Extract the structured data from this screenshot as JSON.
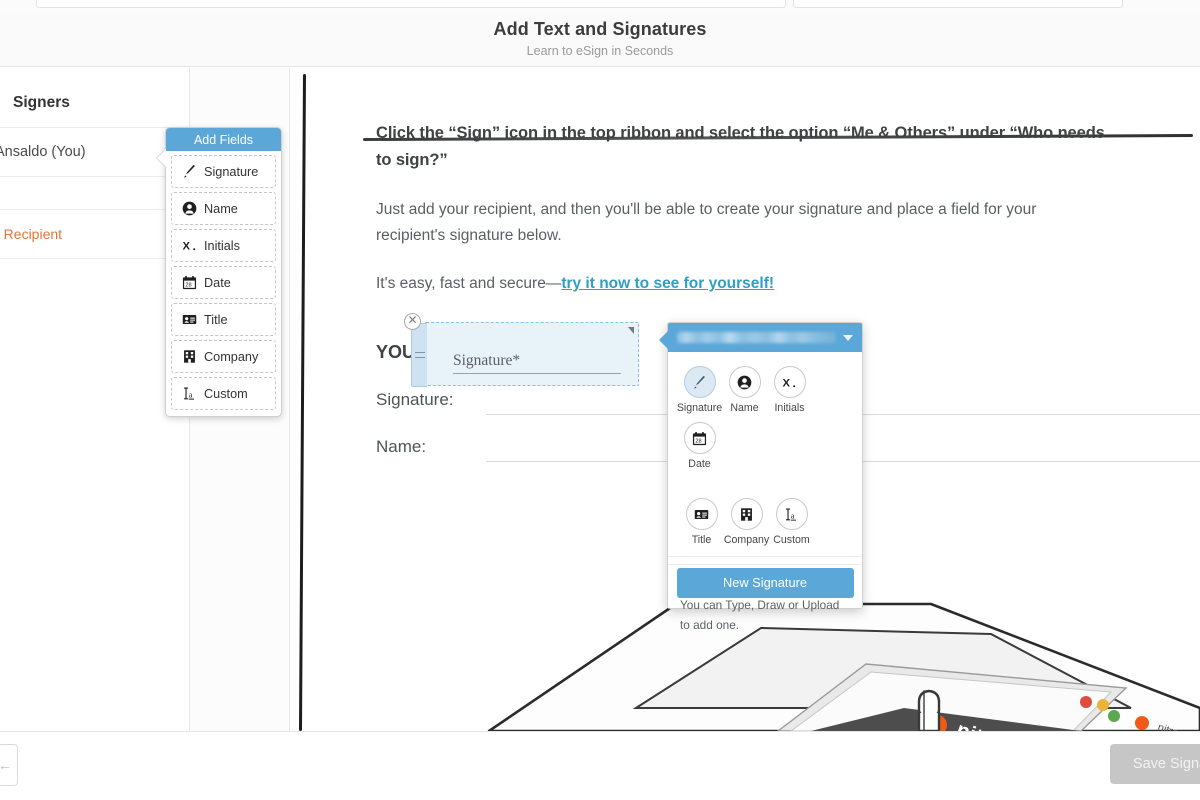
{
  "header": {
    "title": "Add Text and Signatures",
    "subtitle": "Learn to eSign in Seconds"
  },
  "sidebar": {
    "title": "Signers",
    "signer": "Ansaldo (You)",
    "add_recipient": "d Recipient"
  },
  "add_fields_panel": {
    "title": "Add Fields",
    "items": [
      {
        "label": "Signature",
        "icon": "pen-icon"
      },
      {
        "label": "Name",
        "icon": "person-icon"
      },
      {
        "label": "Initials",
        "icon": "initials-icon"
      },
      {
        "label": "Date",
        "icon": "calendar-icon"
      },
      {
        "label": "Title",
        "icon": "id-card-icon"
      },
      {
        "label": "Company",
        "icon": "building-icon"
      },
      {
        "label": "Custom",
        "icon": "custom-text-icon"
      }
    ]
  },
  "document": {
    "heading": "Click the “Sign” icon in the top ribbon and select the option “Me & Others” under “Who needs to sign?”",
    "paragraph_1": "Just add your recipient, and then you'll be able to create your signature and place a field for your recipient's signature below.",
    "paragraph_2_prefix": "It's easy, fast and secure—",
    "paragraph_2_link": "try it now to see for yourself!",
    "you_label": "YOU:",
    "signature_field_placeholder": "Signature*",
    "line_labels": [
      "Signature:",
      "Name:"
    ],
    "illustration_brand": "nitro"
  },
  "signature_popup": {
    "account_email_redacted": "",
    "tools": [
      {
        "label": "Signature",
        "icon": "pen-icon",
        "active": true
      },
      {
        "label": "Name",
        "icon": "person-icon",
        "active": false
      },
      {
        "label": "Initials",
        "icon": "initials-icon",
        "active": false
      },
      {
        "label": "Date",
        "icon": "calendar-icon",
        "active": false
      },
      {
        "label": "Title",
        "icon": "id-card-icon",
        "active": false
      },
      {
        "label": "Company",
        "icon": "building-icon",
        "active": false
      },
      {
        "label": "Custom",
        "icon": "custom-text-icon",
        "active": false
      }
    ],
    "note": "You have no saved signatures. You can Type, Draw or Upload to add one.",
    "primary_button": "New Signature"
  },
  "footer": {
    "save_button": "Save Signature"
  },
  "colors": {
    "accent_blue": "#5ba7d8",
    "link_blue": "#2f9fc4",
    "orange": "#e2753a",
    "disabled_grey": "#c6c6c6"
  }
}
